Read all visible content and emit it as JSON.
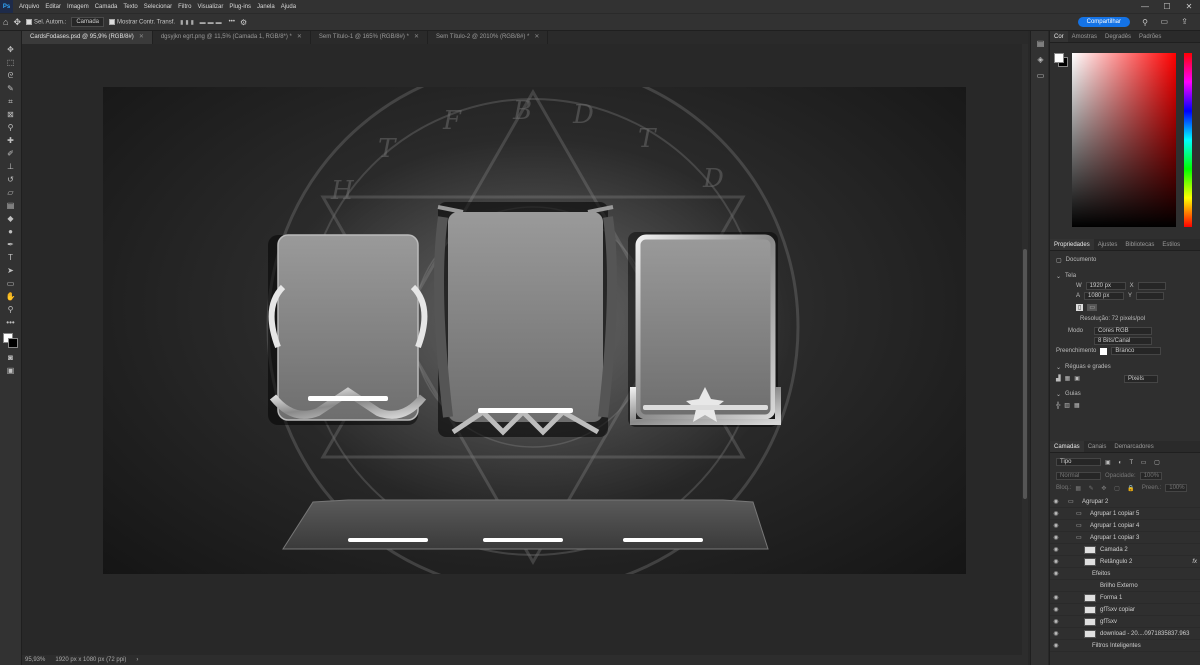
{
  "menu": {
    "logo": "Ps",
    "items": [
      "Arquivo",
      "Editar",
      "Imagem",
      "Camada",
      "Texto",
      "Selecionar",
      "Filtro",
      "Visualizar",
      "Plug-ins",
      "Janela",
      "Ajuda"
    ]
  },
  "window_controls": {
    "minimize": "—",
    "maximize": "☐",
    "close": "✕"
  },
  "options": {
    "auto_select_label": "Sel. Autom.:",
    "auto_select_value": "Camada",
    "show_transform_label": "Mostrar Contr. Transf.",
    "more": "•••",
    "share_label": "Compartilhar"
  },
  "doc_tabs": [
    {
      "label": "CardsFodases.psd @ 95,9% (RGB/8#)",
      "active": true
    },
    {
      "label": "dgsyjkn egrt.png @ 11,5% (Camada 1, RGB/8*) *",
      "active": false
    },
    {
      "label": "Sem Título-1 @ 165% (RGB/8#) *",
      "active": false
    },
    {
      "label": "Sem Título-2 @ 2010% (RGB/8#) *",
      "active": false
    }
  ],
  "status": {
    "zoom": "95,93%",
    "info": "1920 px x 1080 px (72 ppi)"
  },
  "color_panel": {
    "tabs": [
      "Cor",
      "Amostras",
      "Degradês",
      "Padrões"
    ],
    "active": "Cor"
  },
  "properties_panel": {
    "tabs": [
      "Propriedades",
      "Ajustes",
      "Bibliotecas",
      "Estilos"
    ],
    "doc_label": "Documento",
    "canvas_section": "Tela",
    "w_label": "W",
    "w_value": "1920 px",
    "h_label": "A",
    "h_value": "1080 px",
    "x_label": "X",
    "y_label": "Y",
    "resolution": "Resolução: 72 pixels/pol",
    "mode_label": "Modo",
    "mode_value": "Cores RGB",
    "depth_value": "8 Bits/Canal",
    "fill_label": "Preenchimento",
    "fill_value": "Branco",
    "rulers_section": "Réguas e grades",
    "rulers_unit": "Pixels",
    "guides_section": "Guias"
  },
  "layers_panel": {
    "tabs": [
      "Camadas",
      "Canais",
      "Demarcadores"
    ],
    "filter_label": "Tipo",
    "blend_mode": "Normal",
    "opacity_label": "Opacidade:",
    "opacity_value": "100%",
    "lock_label": "Bloq.:",
    "fill_label": "Preen.:",
    "fill_value": "100%",
    "layers": [
      {
        "name": "Agrupar 2",
        "type": "folder",
        "indent": 0
      },
      {
        "name": "Agrupar 1 copiar 5",
        "type": "folder",
        "indent": 1
      },
      {
        "name": "Agrupar 1 copiar 4",
        "type": "folder",
        "indent": 1
      },
      {
        "name": "Agrupar 1 copiar 3",
        "type": "folder",
        "indent": 1
      },
      {
        "name": "Camada 2",
        "type": "mask",
        "indent": 2
      },
      {
        "name": "Retângulo 2",
        "type": "layer",
        "indent": 2,
        "fx": "fx"
      },
      {
        "name": "Efeitos",
        "type": "sub",
        "indent": 3
      },
      {
        "name": "Brilho Externo",
        "type": "sub",
        "indent": 4
      },
      {
        "name": "Forma 1",
        "type": "layer",
        "indent": 2
      },
      {
        "name": "gfTsxv copiar",
        "type": "layer",
        "indent": 2
      },
      {
        "name": "gfTsxv",
        "type": "layer",
        "indent": 2
      },
      {
        "name": "download - 20....0971835837.963",
        "type": "layer",
        "indent": 2
      },
      {
        "name": "Filtros Inteligentes",
        "type": "sub",
        "indent": 3
      }
    ]
  }
}
